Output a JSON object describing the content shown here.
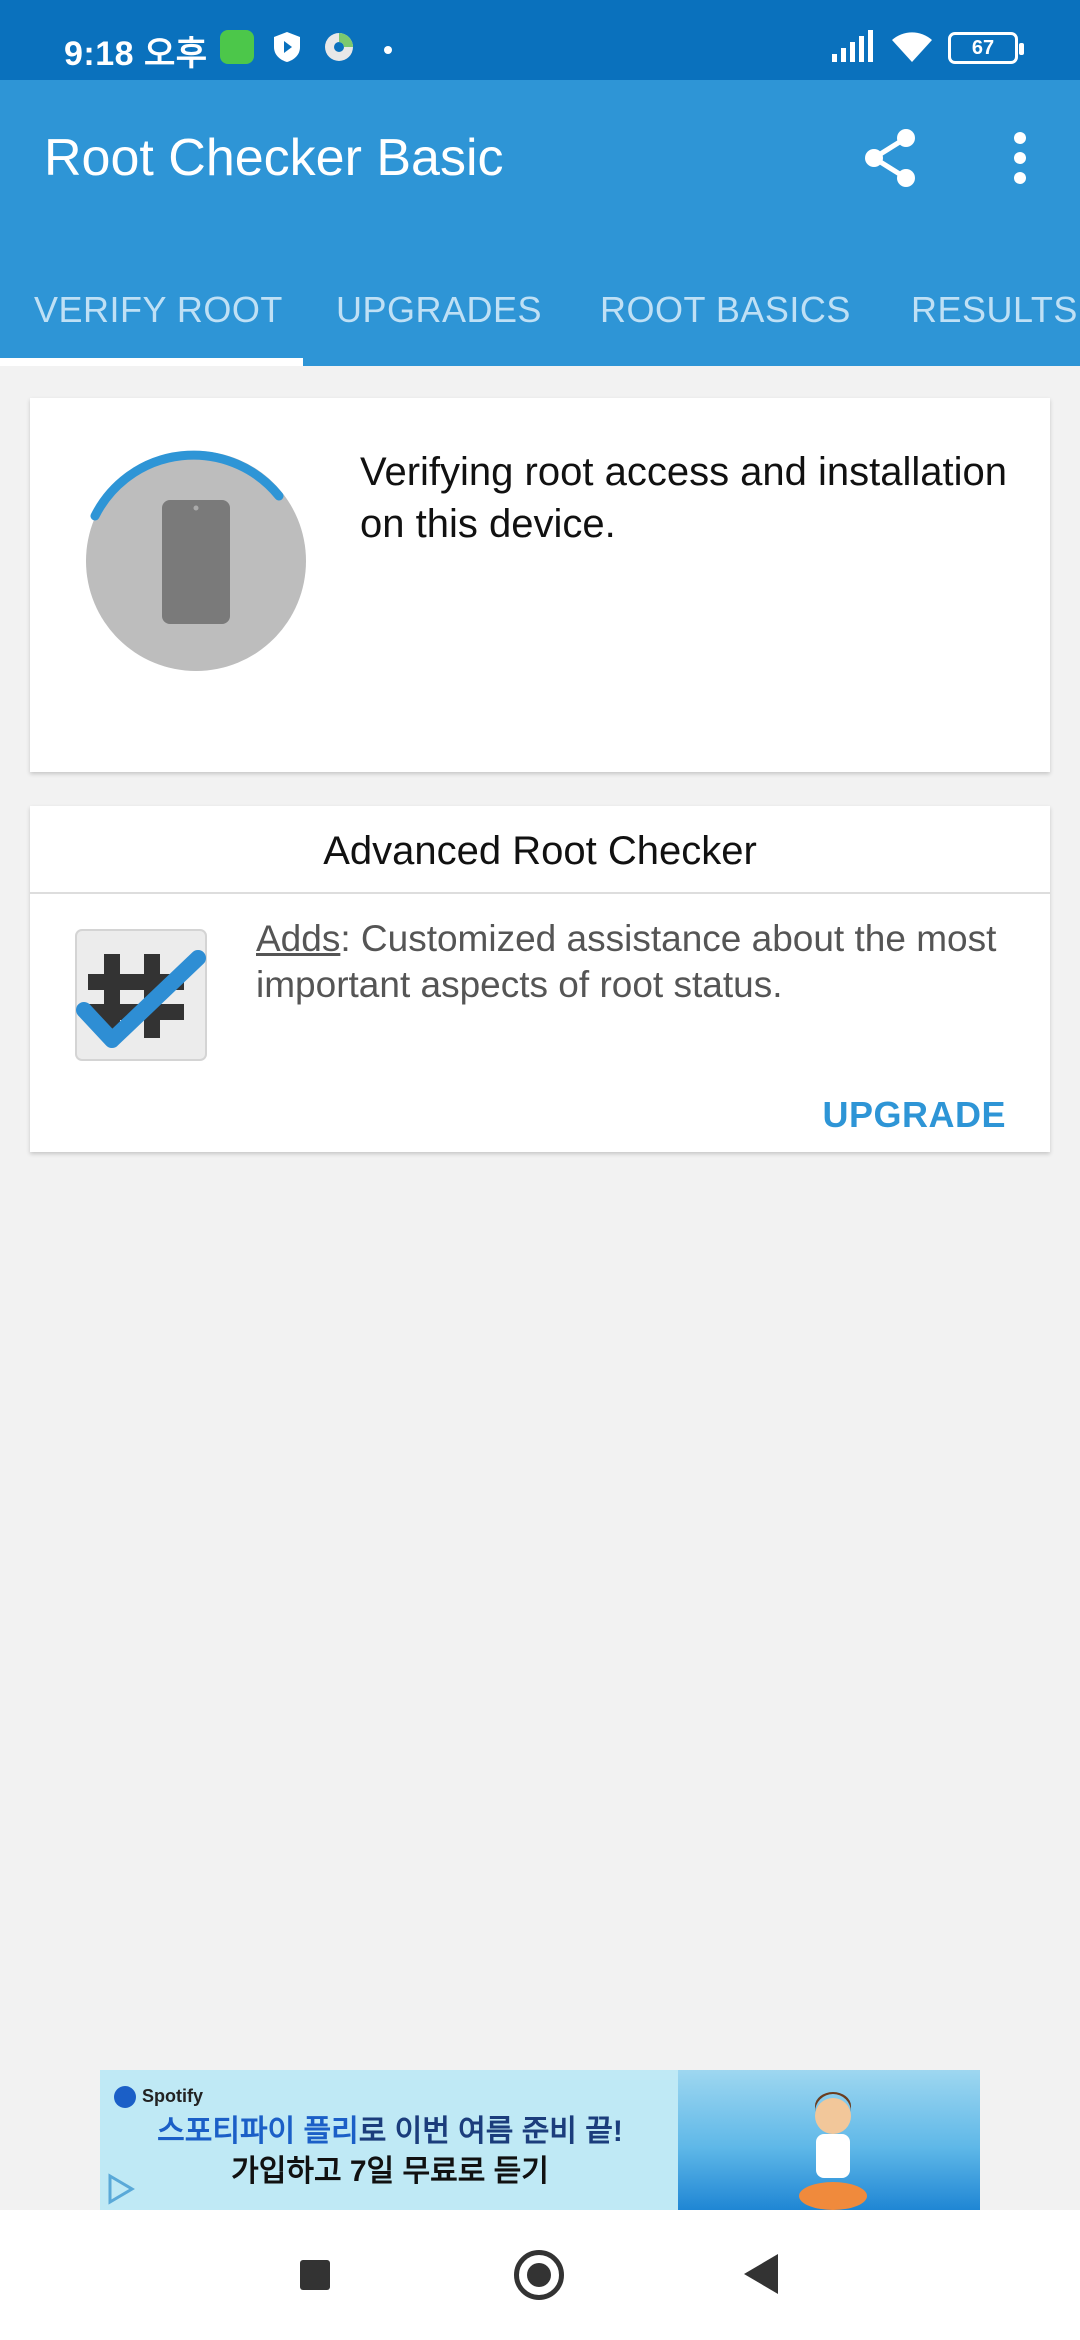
{
  "status_bar": {
    "time": "9:18 오후",
    "battery": "67"
  },
  "app_bar": {
    "title": "Root Checker Basic",
    "share_icon": "share-icon",
    "menu_icon": "more-vert-icon"
  },
  "tabs": [
    {
      "label": "VERIFY ROOT",
      "active": true
    },
    {
      "label": "UPGRADES",
      "active": false
    },
    {
      "label": "ROOT BASICS",
      "active": false
    },
    {
      "label": "RESULTS",
      "active": false
    }
  ],
  "verify_card": {
    "message": "Verifying root access and installation on this device.",
    "icon": "phone-icon",
    "accent_color": "#2e95d6"
  },
  "advanced_card": {
    "title": "Advanced Root Checker",
    "adds_label": "Adds",
    "description": ": Customized assistance about the most important aspects of root status.",
    "upgrade_label": "UPGRADE",
    "icon": "hash-check-icon"
  },
  "ad": {
    "brand": "Spotify",
    "line1_highlight": "스포티파이 플리",
    "line1_rest": "로 이번 여름 준비 끝!",
    "line2": "가입하고 7일 무료로 듣기"
  },
  "colors": {
    "status_bar": "#0a71bd",
    "primary": "#2e95d6",
    "background": "#f2f2f2"
  }
}
